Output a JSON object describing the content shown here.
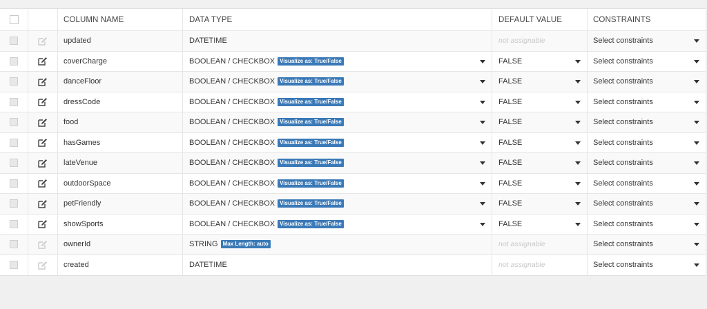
{
  "headers": {
    "column_name": "COLUMN NAME",
    "data_type": "DATA TYPE",
    "default_value": "DEFAULT VALUE",
    "constraints": "CONSTRAINTS"
  },
  "rows": [
    {
      "name": "updated",
      "type": "DATETIME",
      "badge": "",
      "default": "not assignable",
      "default_assignable": false,
      "constraints": "Select constraints",
      "editable": false
    },
    {
      "name": "coverCharge",
      "type": "BOOLEAN / CHECKBOX",
      "badge": "Visualize as: True/False",
      "default": "FALSE",
      "default_assignable": true,
      "constraints": "Select constraints",
      "editable": true
    },
    {
      "name": "danceFloor",
      "type": "BOOLEAN / CHECKBOX",
      "badge": "Visualize as: True/False",
      "default": "FALSE",
      "default_assignable": true,
      "constraints": "Select constraints",
      "editable": true
    },
    {
      "name": "dressCode",
      "type": "BOOLEAN / CHECKBOX",
      "badge": "Visualize as: True/False",
      "default": "FALSE",
      "default_assignable": true,
      "constraints": "Select constraints",
      "editable": true
    },
    {
      "name": "food",
      "type": "BOOLEAN / CHECKBOX",
      "badge": "Visualize as: True/False",
      "default": "FALSE",
      "default_assignable": true,
      "constraints": "Select constraints",
      "editable": true
    },
    {
      "name": "hasGames",
      "type": "BOOLEAN / CHECKBOX",
      "badge": "Visualize as: True/False",
      "default": "FALSE",
      "default_assignable": true,
      "constraints": "Select constraints",
      "editable": true
    },
    {
      "name": "lateVenue",
      "type": "BOOLEAN / CHECKBOX",
      "badge": "Visualize as: True/False",
      "default": "FALSE",
      "default_assignable": true,
      "constraints": "Select constraints",
      "editable": true
    },
    {
      "name": "outdoorSpace",
      "type": "BOOLEAN / CHECKBOX",
      "badge": "Visualize as: True/False",
      "default": "FALSE",
      "default_assignable": true,
      "constraints": "Select constraints",
      "editable": true
    },
    {
      "name": "petFriendly",
      "type": "BOOLEAN / CHECKBOX",
      "badge": "Visualize as: True/False",
      "default": "FALSE",
      "default_assignable": true,
      "constraints": "Select constraints",
      "editable": true
    },
    {
      "name": "showSports",
      "type": "BOOLEAN / CHECKBOX",
      "badge": "Visualize as: True/False",
      "default": "FALSE",
      "default_assignable": true,
      "constraints": "Select constraints",
      "editable": true
    },
    {
      "name": "ownerId",
      "type": "STRING",
      "badge": "Max Length: auto",
      "default": "not assignable",
      "default_assignable": false,
      "constraints": "Select constraints",
      "editable": false
    },
    {
      "name": "created",
      "type": "DATETIME",
      "badge": "",
      "default": "not assignable",
      "default_assignable": false,
      "constraints": "Select constraints",
      "editable": false
    }
  ],
  "colors": {
    "badge": "#3a79b7",
    "edit_icon_active": "#444444",
    "edit_icon_disabled": "#cccccc"
  },
  "icons": {
    "edit": "pencil-square-icon",
    "dropdown": "caret-down-icon"
  }
}
